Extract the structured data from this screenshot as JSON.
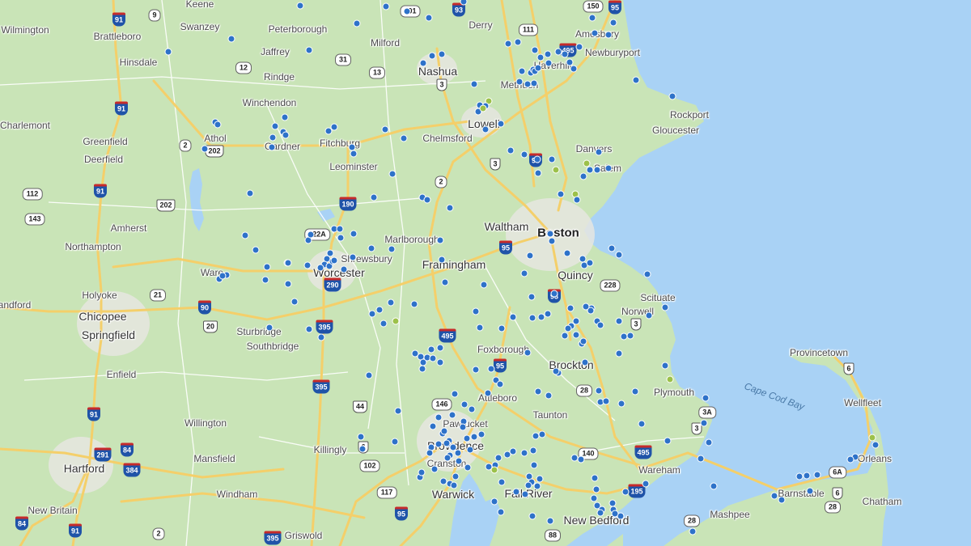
{
  "colors": {
    "land": "#c9e4b7",
    "water": "#a9d2f5",
    "highway": "#f4cf6a",
    "road": "#ffffff",
    "urban": "#e6e6e1",
    "marker_blue": "#2e72c9",
    "marker_green": "#9cc14a"
  },
  "places": [
    {
      "name": "Keene",
      "kind": "town"
    },
    {
      "name": "Wilmington",
      "kind": "town"
    },
    {
      "name": "Brattleboro",
      "kind": "town"
    },
    {
      "name": "Swanzey",
      "kind": "town"
    },
    {
      "name": "Peterborough",
      "kind": "town"
    },
    {
      "name": "Milford",
      "kind": "town"
    },
    {
      "name": "Derry",
      "kind": "town"
    },
    {
      "name": "Amesbury",
      "kind": "town"
    },
    {
      "name": "Newburyport",
      "kind": "town"
    },
    {
      "name": "Hinsdale",
      "kind": "town"
    },
    {
      "name": "Jaffrey",
      "kind": "town"
    },
    {
      "name": "Nashua",
      "kind": "city"
    },
    {
      "name": "Haverhill",
      "kind": "town"
    },
    {
      "name": "Methuen",
      "kind": "town"
    },
    {
      "name": "Rindge",
      "kind": "town"
    },
    {
      "name": "Winchendon",
      "kind": "town"
    },
    {
      "name": "Rockport",
      "kind": "town"
    },
    {
      "name": "Charlemont",
      "kind": "town"
    },
    {
      "name": "Lowell",
      "kind": "city"
    },
    {
      "name": "Gloucester",
      "kind": "town"
    },
    {
      "name": "Athol",
      "kind": "town"
    },
    {
      "name": "Greenfield",
      "kind": "town"
    },
    {
      "name": "Chelmsford",
      "kind": "town"
    },
    {
      "name": "Fitchburg",
      "kind": "town"
    },
    {
      "name": "Gardner",
      "kind": "town"
    },
    {
      "name": "Danvers",
      "kind": "town"
    },
    {
      "name": "Deerfield",
      "kind": "town"
    },
    {
      "name": "Salem",
      "kind": "town"
    },
    {
      "name": "Leominster",
      "kind": "town"
    },
    {
      "name": "Waltham",
      "kind": "city"
    },
    {
      "name": "Amherst",
      "kind": "town"
    },
    {
      "name": "Boston",
      "kind": "big"
    },
    {
      "name": "Marlborough",
      "kind": "town"
    },
    {
      "name": "Northampton",
      "kind": "town"
    },
    {
      "name": "Shrewsbury",
      "kind": "town"
    },
    {
      "name": "Framingham",
      "kind": "city"
    },
    {
      "name": "Worcester",
      "kind": "city"
    },
    {
      "name": "Ware",
      "kind": "town"
    },
    {
      "name": "Quincy",
      "kind": "city"
    },
    {
      "name": "Scituate",
      "kind": "town"
    },
    {
      "name": "Holyoke",
      "kind": "town"
    },
    {
      "name": "andford",
      "kind": "town"
    },
    {
      "name": "Norwell",
      "kind": "town"
    },
    {
      "name": "Chicopee",
      "kind": "city"
    },
    {
      "name": "Springfield",
      "kind": "city"
    },
    {
      "name": "Sturbridge",
      "kind": "town"
    },
    {
      "name": "Southbridge",
      "kind": "town"
    },
    {
      "name": "Foxborough",
      "kind": "town"
    },
    {
      "name": "Brockton",
      "kind": "city"
    },
    {
      "name": "Provincetown",
      "kind": "town"
    },
    {
      "name": "Enfield",
      "kind": "town"
    },
    {
      "name": "Cape Cod Bay",
      "kind": "water"
    },
    {
      "name": "Plymouth",
      "kind": "town"
    },
    {
      "name": "Attleboro",
      "kind": "town"
    },
    {
      "name": "Wellfleet",
      "kind": "town"
    },
    {
      "name": "Taunton",
      "kind": "town"
    },
    {
      "name": "Willington",
      "kind": "town"
    },
    {
      "name": "Pawtucket",
      "kind": "town"
    },
    {
      "name": "Killingly",
      "kind": "town"
    },
    {
      "name": "Providence",
      "kind": "city"
    },
    {
      "name": "Orleans",
      "kind": "town"
    },
    {
      "name": "Mansfield",
      "kind": "town"
    },
    {
      "name": "Cranston",
      "kind": "town"
    },
    {
      "name": "Hartford",
      "kind": "city"
    },
    {
      "name": "Wareham",
      "kind": "town"
    },
    {
      "name": "Warwick",
      "kind": "city"
    },
    {
      "name": "Fall River",
      "kind": "city"
    },
    {
      "name": "Windham",
      "kind": "town"
    },
    {
      "name": "Barnstable",
      "kind": "town"
    },
    {
      "name": "Chatham",
      "kind": "town"
    },
    {
      "name": "New Britain",
      "kind": "town"
    },
    {
      "name": "Mashpee",
      "kind": "town"
    },
    {
      "name": "New Bedford",
      "kind": "city"
    },
    {
      "name": "Griswold",
      "kind": "town"
    }
  ],
  "route_shields": [
    {
      "label": "9",
      "type": "state"
    },
    {
      "label": "91",
      "type": "interstate"
    },
    {
      "label": "101",
      "type": "state"
    },
    {
      "label": "93",
      "type": "interstate"
    },
    {
      "label": "150",
      "type": "state"
    },
    {
      "label": "95",
      "type": "interstate"
    },
    {
      "label": "111",
      "type": "state"
    },
    {
      "label": "495",
      "type": "interstate"
    },
    {
      "label": "12",
      "type": "state"
    },
    {
      "label": "31",
      "type": "state"
    },
    {
      "label": "13",
      "type": "state"
    },
    {
      "label": "3",
      "type": "us"
    },
    {
      "label": "91",
      "type": "interstate"
    },
    {
      "label": "2",
      "type": "state"
    },
    {
      "label": "202",
      "type": "us"
    },
    {
      "label": "3",
      "type": "us"
    },
    {
      "label": "93",
      "type": "interstate"
    },
    {
      "label": "2",
      "type": "state"
    },
    {
      "label": "91",
      "type": "interstate"
    },
    {
      "label": "112",
      "type": "state"
    },
    {
      "label": "202",
      "type": "us"
    },
    {
      "label": "190",
      "type": "interstate"
    },
    {
      "label": "143",
      "type": "state"
    },
    {
      "label": "122A",
      "type": "state"
    },
    {
      "label": "95",
      "type": "interstate"
    },
    {
      "label": "290",
      "type": "interstate"
    },
    {
      "label": "21",
      "type": "state"
    },
    {
      "label": "93",
      "type": "interstate"
    },
    {
      "label": "228",
      "type": "state"
    },
    {
      "label": "90",
      "type": "interstate"
    },
    {
      "label": "20",
      "type": "us"
    },
    {
      "label": "395",
      "type": "interstate"
    },
    {
      "label": "3",
      "type": "us"
    },
    {
      "label": "495",
      "type": "interstate"
    },
    {
      "label": "95",
      "type": "interstate"
    },
    {
      "label": "6",
      "type": "us"
    },
    {
      "label": "44",
      "type": "us"
    },
    {
      "label": "28",
      "type": "state"
    },
    {
      "label": "395",
      "type": "interstate"
    },
    {
      "label": "146",
      "type": "state"
    },
    {
      "label": "3A",
      "type": "state"
    },
    {
      "label": "91",
      "type": "interstate"
    },
    {
      "label": "3",
      "type": "us"
    },
    {
      "label": "6",
      "type": "us"
    },
    {
      "label": "291",
      "type": "interstate"
    },
    {
      "label": "84",
      "type": "interstate"
    },
    {
      "label": "140",
      "type": "state"
    },
    {
      "label": "495",
      "type": "interstate"
    },
    {
      "label": "384",
      "type": "interstate"
    },
    {
      "label": "102",
      "type": "state"
    },
    {
      "label": "6A",
      "type": "state"
    },
    {
      "label": "6",
      "type": "us"
    },
    {
      "label": "195",
      "type": "interstate"
    },
    {
      "label": "117",
      "type": "state"
    },
    {
      "label": "95",
      "type": "interstate"
    },
    {
      "label": "28",
      "type": "state"
    },
    {
      "label": "84",
      "type": "interstate"
    },
    {
      "label": "91",
      "type": "interstate"
    },
    {
      "label": "28",
      "type": "state"
    },
    {
      "label": "2",
      "type": "state"
    },
    {
      "label": "395",
      "type": "interstate"
    },
    {
      "label": "88",
      "type": "state"
    }
  ]
}
